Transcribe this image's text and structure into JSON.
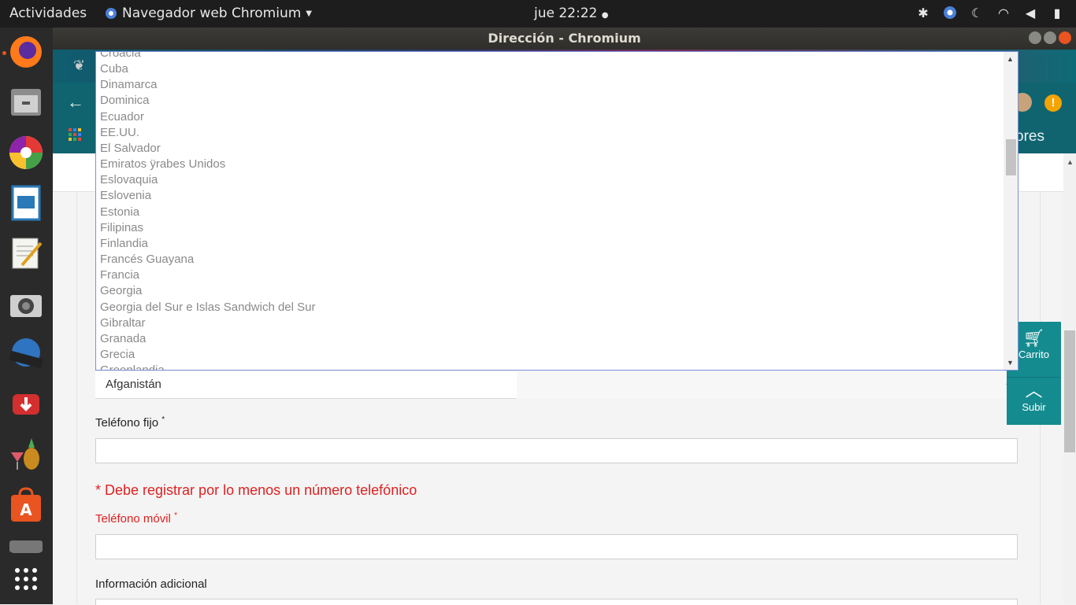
{
  "topbar": {
    "activities": "Actividades",
    "app_menu": "Navegador web Chromium",
    "clock": "jue 22:22",
    "tray_icons": [
      "accessibility-icon",
      "chromium-tray-icon",
      "night-mode-icon",
      "wifi-icon",
      "volume-icon",
      "battery-icon"
    ]
  },
  "window": {
    "title": "Dirección - Chromium"
  },
  "browser": {
    "bookmark_text": "adores"
  },
  "dock": {
    "apps": [
      "firefox",
      "files",
      "picasa",
      "libreoffice-impress",
      "text-editor",
      "camera",
      "openshot",
      "downloader",
      "pineapple-app",
      "software-center",
      "screenshot",
      "show-applications"
    ]
  },
  "dropdown": {
    "options": [
      "Croacia",
      "Cuba",
      "Dinamarca",
      "Dominica",
      "Ecuador",
      "EE.UU.",
      "El Salvador",
      "Emiratos ÿrabes Unidos",
      "Eslovaquia",
      "Eslovenia",
      "Estonia",
      "Filipinas",
      "Finlandia",
      "Francés Guayana",
      "Francia",
      "Georgia",
      "Georgia del Sur e Islas Sandwich del Sur",
      "Gibraltar",
      "Granada",
      "Grecia",
      "Groenlandia"
    ]
  },
  "form": {
    "country_value": "Afganistán",
    "landline_label": "Teléfono fijo",
    "required_mark": "*",
    "phone_warning": "* Debe registrar por lo menos un número telefónico",
    "mobile_label": "Teléfono móvil",
    "additional_info_label": "Información adicional"
  },
  "floating": {
    "cart_label": "Carrito",
    "up_label": "Subir"
  },
  "colors": {
    "accent": "#148b8f",
    "warning": "#e02020",
    "ubuntu_orange": "#e95420"
  }
}
